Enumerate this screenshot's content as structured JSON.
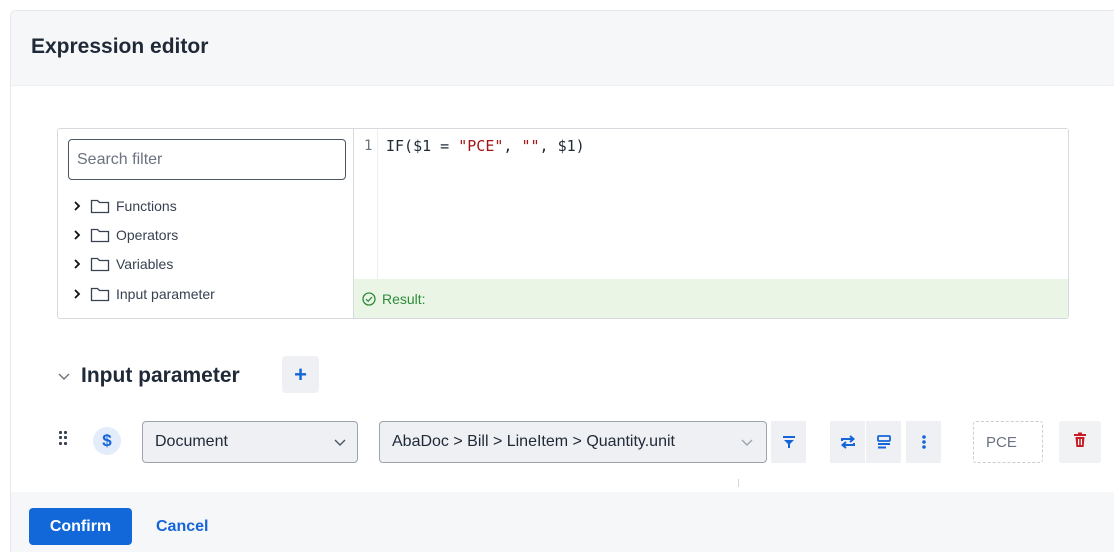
{
  "dialog": {
    "title": "Expression editor"
  },
  "tree": {
    "search_placeholder": "Search filter",
    "items": [
      {
        "label": "Functions",
        "icon": "folder-icon"
      },
      {
        "label": "Operators",
        "icon": "folder-icon"
      },
      {
        "label": "Variables",
        "icon": "folder-icon"
      },
      {
        "label": "Input parameter",
        "icon": "folder-icon"
      }
    ]
  },
  "code": {
    "line_number": "1",
    "tokens": {
      "a": "IF($1 = ",
      "b": "\"PCE\"",
      "c": ", ",
      "d": "\"\"",
      "e": ", $1)"
    }
  },
  "result": {
    "label": "Result:",
    "color": "#2e8b3a"
  },
  "input_parameter": {
    "heading": "Input parameter",
    "add_label": "+",
    "rows": [
      {
        "type_symbol": "$",
        "source": "Document",
        "path": "AbaDoc > Bill > LineItem > Quantity.unit",
        "value_placeholder": "PCE",
        "tools": [
          "filter-icon",
          "swap-icon",
          "format-icon",
          "more-icon"
        ]
      }
    ]
  },
  "footer": {
    "confirm_label": "Confirm",
    "cancel_label": "Cancel"
  },
  "colors": {
    "accent": "#1268d8",
    "danger": "#c81d25",
    "result_bg": "#eaf5e6"
  }
}
